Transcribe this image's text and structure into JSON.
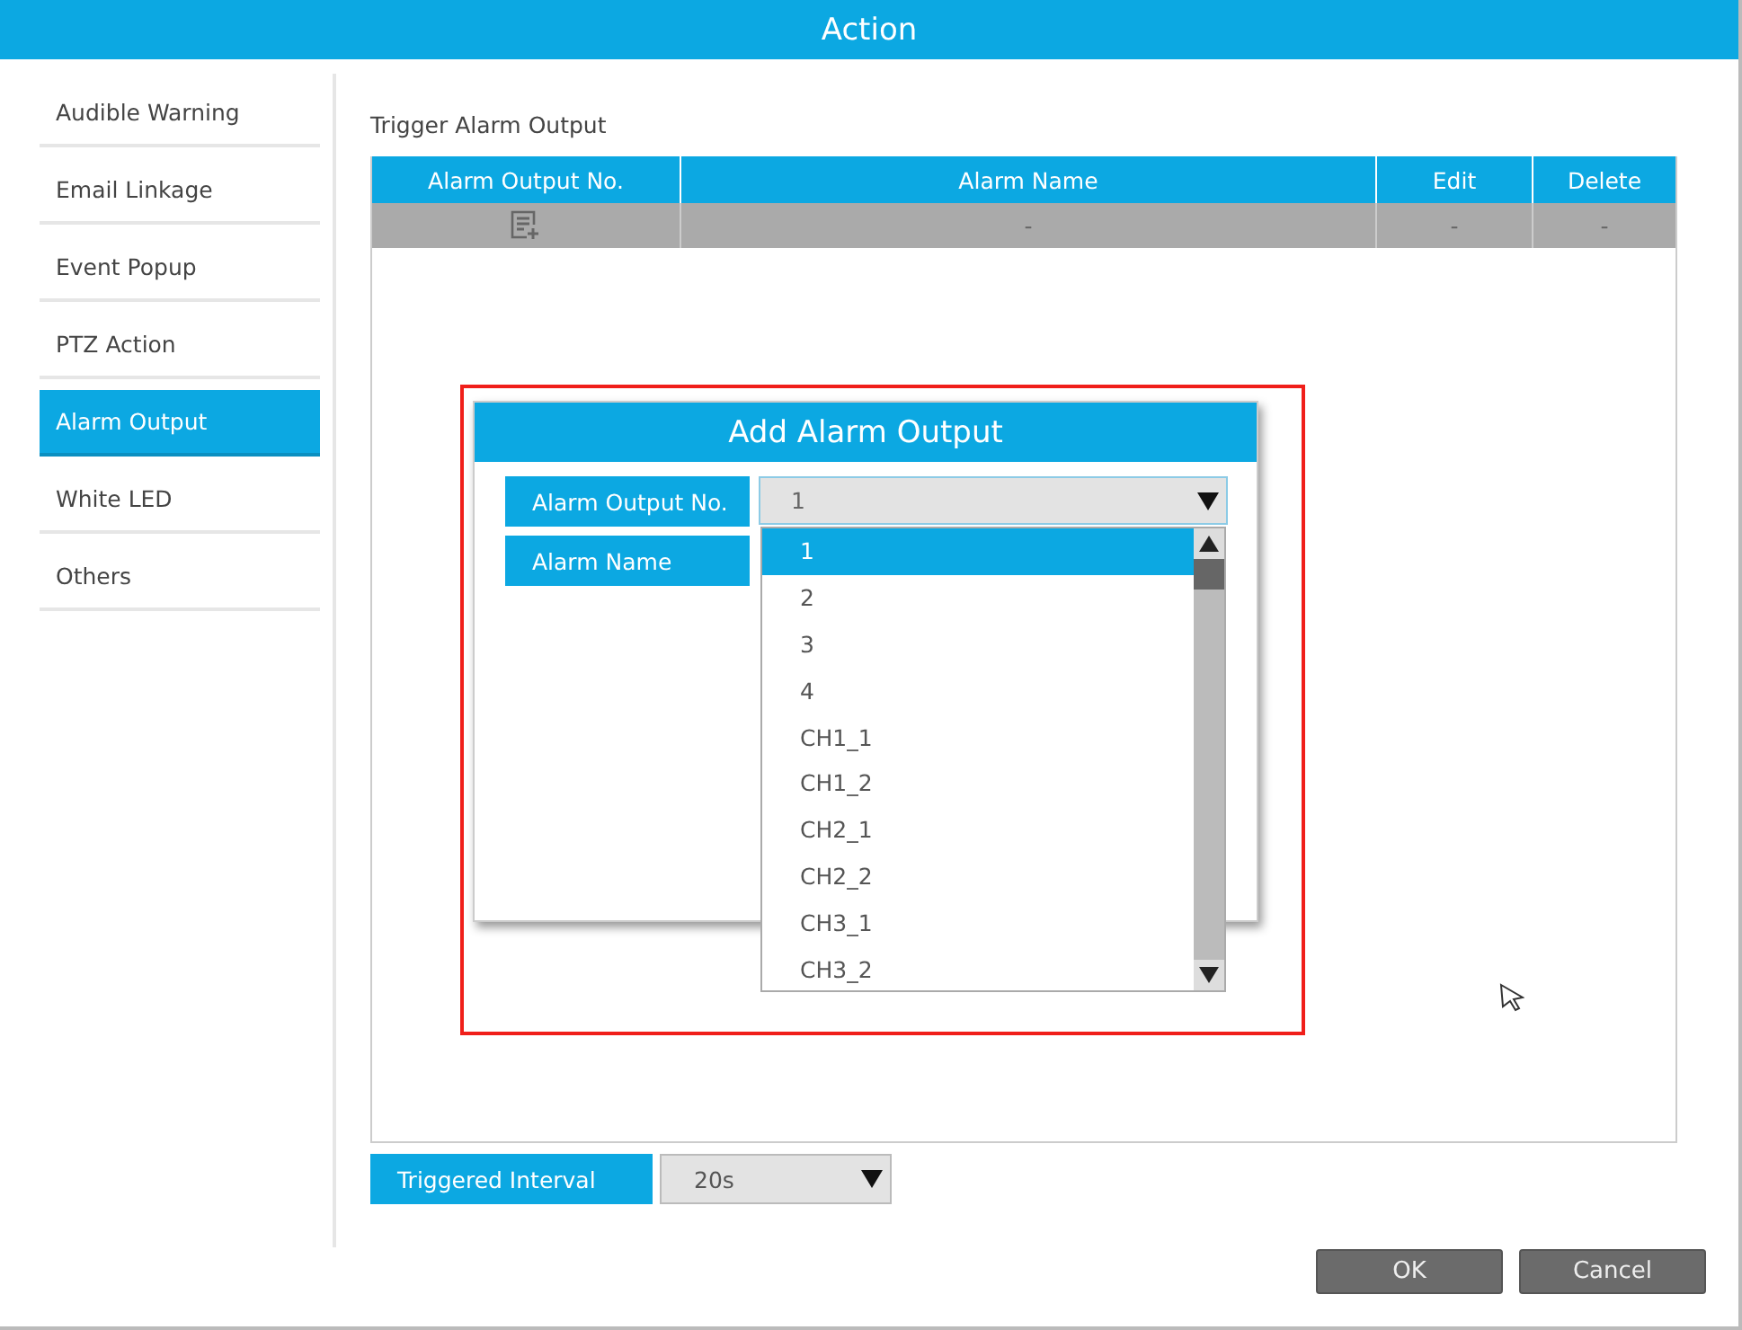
{
  "window": {
    "title": "Action"
  },
  "sidebar": {
    "items": [
      {
        "label": "Audible Warning",
        "selected": false
      },
      {
        "label": "Email Linkage",
        "selected": false
      },
      {
        "label": "Event Popup",
        "selected": false
      },
      {
        "label": "PTZ Action",
        "selected": false
      },
      {
        "label": "Alarm Output",
        "selected": true
      },
      {
        "label": "White LED",
        "selected": false
      },
      {
        "label": "Others",
        "selected": false
      }
    ]
  },
  "section_title": "Trigger Alarm Output",
  "table": {
    "columns": [
      "Alarm Output No.",
      "Alarm Name",
      "Edit",
      "Delete"
    ],
    "rows": [
      {
        "cells": [
          {
            "kind": "add_icon"
          },
          {
            "kind": "text",
            "text": "-"
          },
          {
            "kind": "text",
            "text": "-"
          },
          {
            "kind": "text",
            "text": "-"
          }
        ]
      }
    ]
  },
  "triggered_interval": {
    "label": "Triggered Interval",
    "value": "20s"
  },
  "buttons": [
    "OK",
    "Cancel"
  ],
  "dialog": {
    "title": "Add Alarm Output",
    "fields": [
      {
        "label": "Alarm Output No.",
        "kind": "select",
        "value": "1"
      },
      {
        "label": "Alarm Name",
        "kind": "text"
      }
    ]
  },
  "dropdown": {
    "options": [
      {
        "label": "1",
        "selected": true
      },
      {
        "label": "2",
        "selected": false
      },
      {
        "label": "3",
        "selected": false
      },
      {
        "label": "4",
        "selected": false
      },
      {
        "label": "CH1_1",
        "selected": false
      },
      {
        "label": "CH1_2",
        "selected": false
      },
      {
        "label": "CH2_1",
        "selected": false
      },
      {
        "label": "CH2_2",
        "selected": false
      },
      {
        "label": "CH3_1",
        "selected": false
      },
      {
        "label": "CH3_2",
        "selected": false
      }
    ]
  }
}
